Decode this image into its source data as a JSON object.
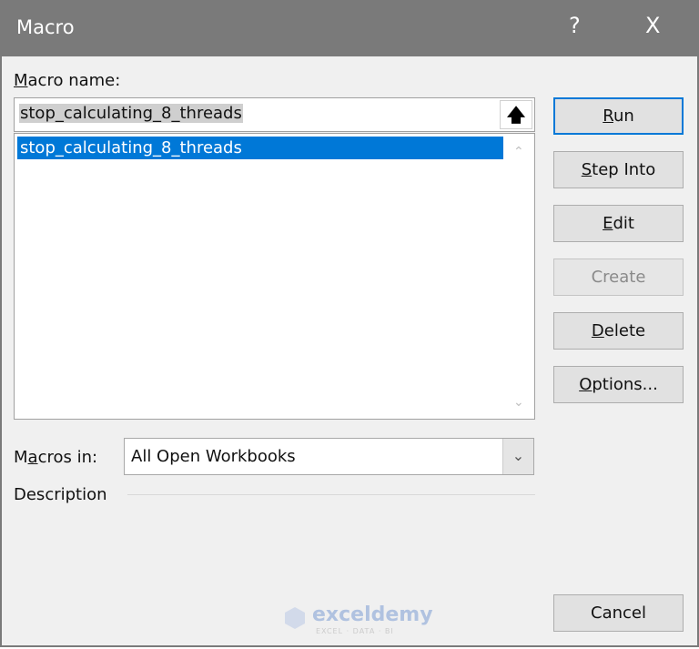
{
  "window": {
    "title": "Macro",
    "help": "?",
    "close": "X"
  },
  "macro_name": {
    "label_key": "M",
    "label_rest": "acro name:",
    "value": "stop_calculating_8_threads",
    "upload_icon": "arrow-up-icon"
  },
  "list": {
    "items": [
      "stop_calculating_8_threads"
    ],
    "selected_color": "#0078d7"
  },
  "buttons": {
    "run": {
      "pre": "",
      "key": "R",
      "post": "un"
    },
    "step_into": {
      "pre": "",
      "key": "S",
      "post": "tep Into"
    },
    "edit": {
      "pre": "",
      "key": "E",
      "post": "dit"
    },
    "create": {
      "label": "Create"
    },
    "delete": {
      "pre": "",
      "key": "D",
      "post": "elete"
    },
    "options": {
      "pre": "",
      "key": "O",
      "post": "ptions..."
    },
    "cancel": {
      "label": "Cancel"
    }
  },
  "macros_in": {
    "pre": "M",
    "key": "a",
    "post": "cros in:",
    "value": "All Open Workbooks"
  },
  "description": {
    "label": "Description"
  },
  "watermark": {
    "name": "exceldemy",
    "tagline": "EXCEL · DATA · BI"
  }
}
